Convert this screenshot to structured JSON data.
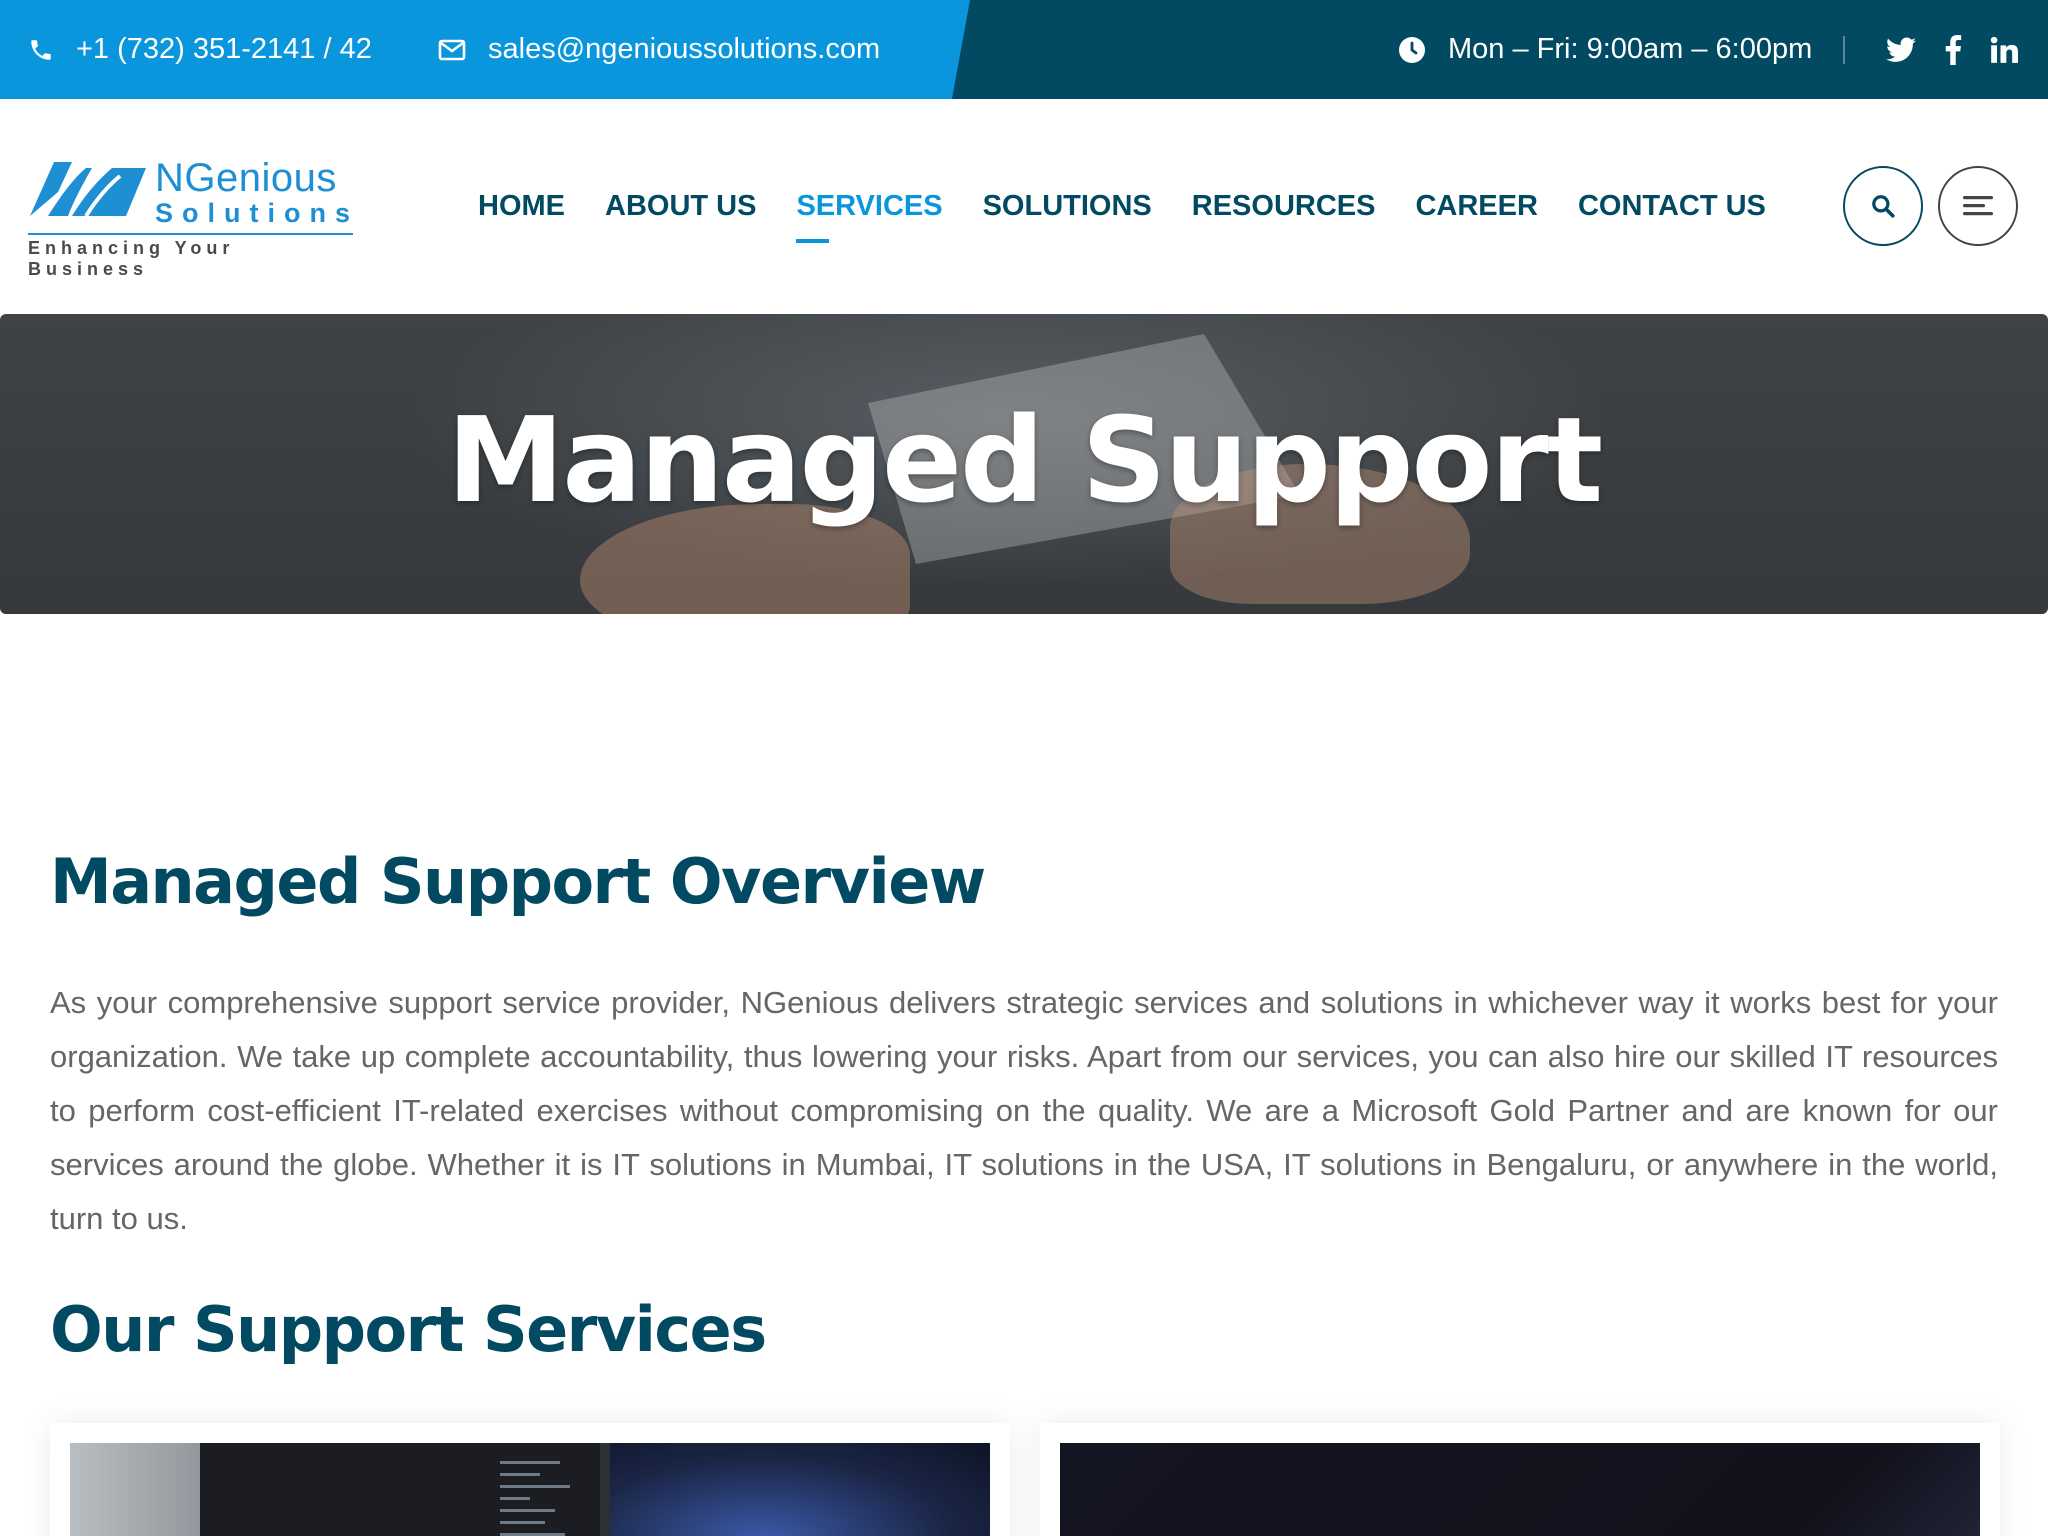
{
  "topbar": {
    "phone": "+1 (732) 351-2141 / 42",
    "email": "sales@ngenioussolutions.com",
    "hours": "Mon – Fri: 9:00am – 6:00pm",
    "social": [
      "twitter-icon",
      "facebook-icon",
      "linkedin-icon"
    ]
  },
  "logo": {
    "line1": "NGenious",
    "line2": "Solutions",
    "tagline": "Enhancing Your Business"
  },
  "nav": {
    "items": [
      {
        "label": "HOME"
      },
      {
        "label": "ABOUT US"
      },
      {
        "label": "SERVICES",
        "active": true
      },
      {
        "label": "SOLUTIONS"
      },
      {
        "label": "RESOURCES"
      },
      {
        "label": "CAREER"
      },
      {
        "label": "CONTACT US"
      }
    ]
  },
  "banner": {
    "title": "Managed Support"
  },
  "overview": {
    "heading": "Managed Support Overview",
    "text": "As your comprehensive support service provider, NGenious delivers strategic services and solutions in whichever way it works best for your organization. We take up complete accountability, thus lowering your risks. Apart from our services, you can also hire our skilled IT resources to perform cost-efficient IT-related exercises without compromising on the quality. We are a Microsoft Gold Partner and are known for our services around the globe. Whether it is IT solutions in Mumbai, IT solutions in the USA, IT solutions in Bengaluru, or anywhere in the world, turn to us."
  },
  "services": {
    "heading": "Our Support Services"
  },
  "colors": {
    "brand_dark": "#024a62",
    "brand_blue": "#0996dc",
    "text_muted": "#666666"
  }
}
